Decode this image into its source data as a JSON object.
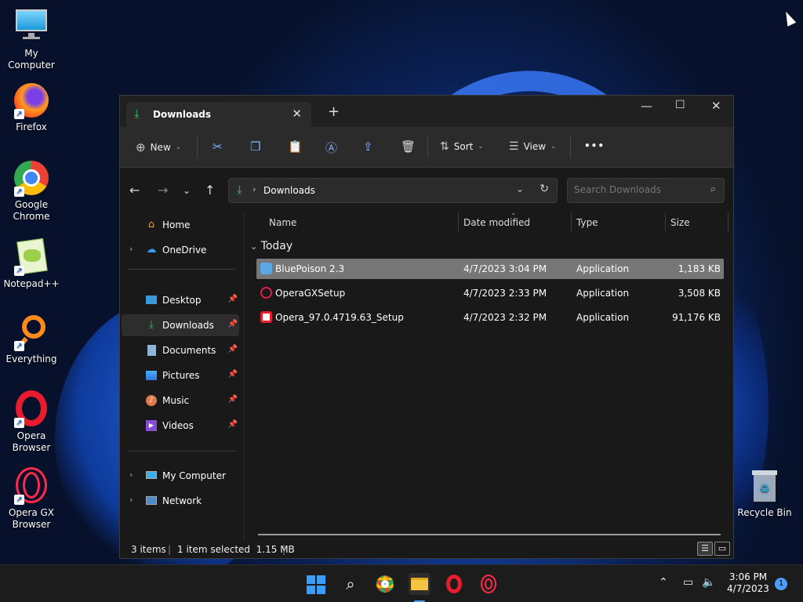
{
  "desktop": {
    "icons": [
      {
        "label": "My Computer"
      },
      {
        "label": "Firefox"
      },
      {
        "label": "Google Chrome"
      },
      {
        "label": "Notepad++"
      },
      {
        "label": "Everything"
      },
      {
        "label": "Opera Browser"
      },
      {
        "label": "Opera GX Browser"
      },
      {
        "label": "Recycle Bin"
      }
    ]
  },
  "window": {
    "tab_title": "Downloads",
    "toolbar": {
      "new_label": "New",
      "sort_label": "Sort",
      "view_label": "View",
      "more_label": "•••"
    },
    "address": {
      "path": "Downloads"
    },
    "search": {
      "placeholder": "Search Downloads"
    },
    "nav": {
      "items": [
        {
          "label": "Home"
        },
        {
          "label": "OneDrive"
        },
        {
          "label": "Desktop"
        },
        {
          "label": "Downloads"
        },
        {
          "label": "Documents"
        },
        {
          "label": "Pictures"
        },
        {
          "label": "Music"
        },
        {
          "label": "Videos"
        },
        {
          "label": "My Computer"
        },
        {
          "label": "Network"
        }
      ]
    },
    "columns": {
      "name": "Name",
      "date": "Date modified",
      "type": "Type",
      "size": "Size"
    },
    "group_label": "Today",
    "files": [
      {
        "name": "BluePoison 2.3",
        "date": "4/7/2023 3:04 PM",
        "type": "Application",
        "size": "1,183 KB"
      },
      {
        "name": "OperaGXSetup",
        "date": "4/7/2023 2:33 PM",
        "type": "Application",
        "size": "3,508 KB"
      },
      {
        "name": "Opera_97.0.4719.63_Setup",
        "date": "4/7/2023 2:32 PM",
        "type": "Application",
        "size": "91,176 KB"
      }
    ],
    "status": {
      "count": "3 items",
      "selected": "1 item selected  1.15 MB"
    }
  },
  "taskbar": {
    "time": "3:06 PM",
    "date": "4/7/2023",
    "notification_count": "1"
  },
  "colors": {
    "accent": "#4a9dff",
    "selection": "#777777",
    "window_bg": "#191919"
  }
}
